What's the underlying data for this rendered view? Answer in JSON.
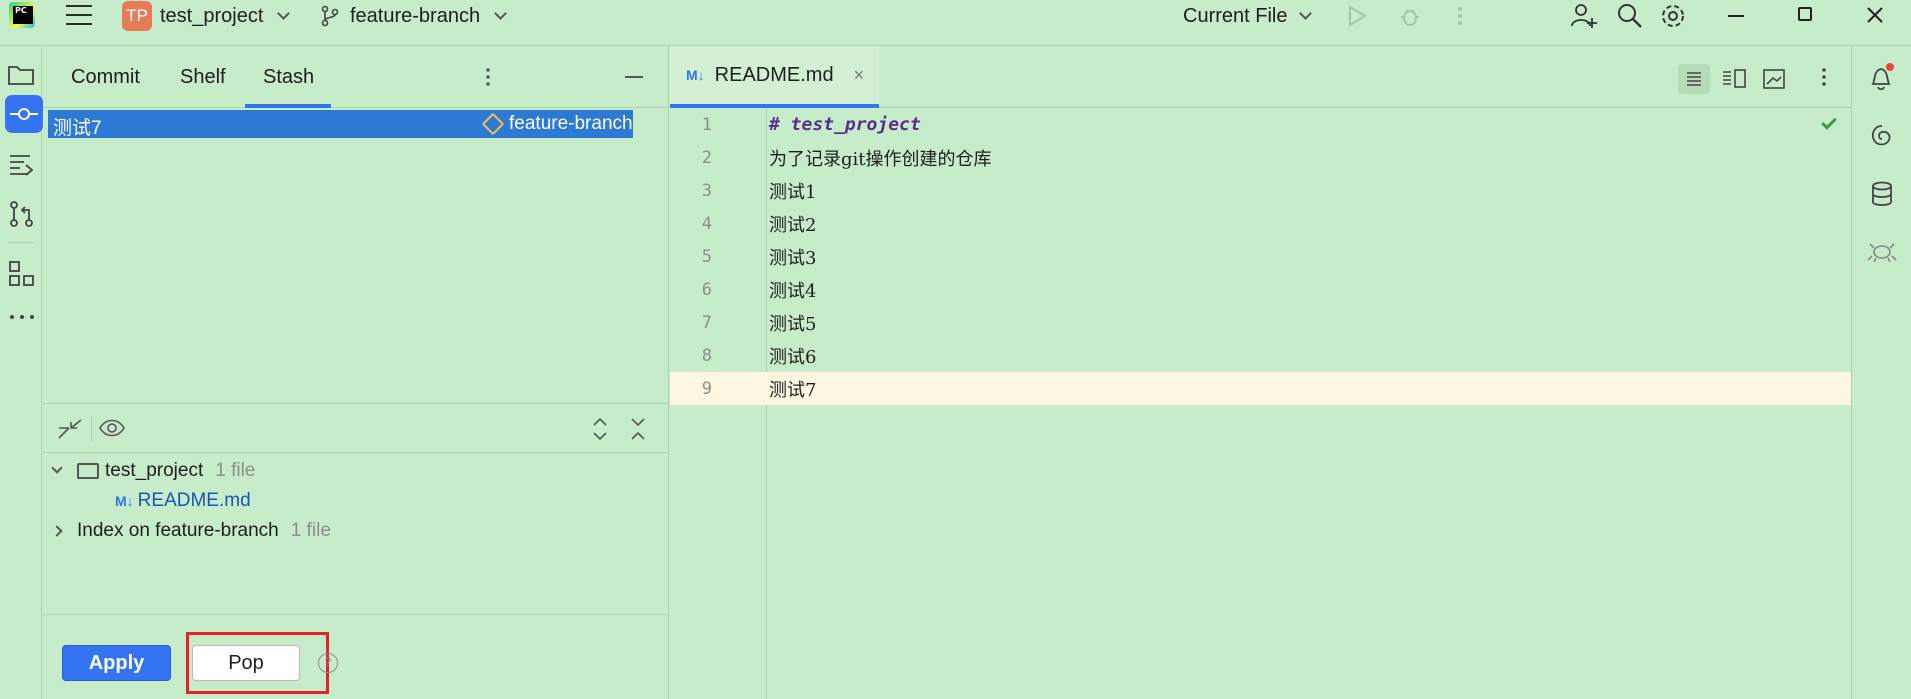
{
  "titlebar": {
    "project_badge": "TP",
    "project_name": "test_project",
    "branch": "feature-branch",
    "run_config": "Current File"
  },
  "panel": {
    "tabs": [
      {
        "label": "Commit",
        "active": false
      },
      {
        "label": "Shelf",
        "active": false
      },
      {
        "label": "Stash",
        "active": true
      }
    ],
    "stash_entry": {
      "message": "测试7",
      "branch": "feature-branch"
    },
    "tree": [
      {
        "label": "test_project",
        "count": "1 file",
        "expanded": true
      },
      {
        "label": "README.md",
        "badge": "M↓"
      },
      {
        "label": "Index on feature-branch",
        "count": "1 file",
        "expanded": false
      }
    ],
    "buttons": {
      "apply": "Apply",
      "pop": "Pop",
      "help": "?"
    }
  },
  "editor": {
    "tab": {
      "badge": "M↓",
      "filename": "README.md",
      "close": "×"
    },
    "lines": [
      {
        "no": "1",
        "text": "# test_project"
      },
      {
        "no": "2",
        "text": "为了记录git操作创建的仓库"
      },
      {
        "no": "3",
        "text": "测试1"
      },
      {
        "no": "4",
        "text": "测试2"
      },
      {
        "no": "5",
        "text": "测试3"
      },
      {
        "no": "6",
        "text": "测试4"
      },
      {
        "no": "7",
        "text": "测试5"
      },
      {
        "no": "8",
        "text": "测试6"
      },
      {
        "no": "9",
        "text": "测试7"
      }
    ],
    "current_line": "9"
  },
  "colors": {
    "background": "#c6ecc9",
    "accent": "#3574f0",
    "selection": "#2d7ad4",
    "highlight_box": "#e8202a",
    "current_line": "#fdf7e1"
  }
}
